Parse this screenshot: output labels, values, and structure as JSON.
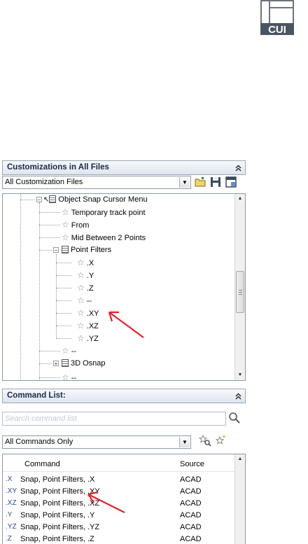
{
  "cui_icon": {
    "label": "CUI",
    "icon": "cui-icon"
  },
  "customizations": {
    "header": "Customizations in All Files",
    "collapse_glyph": "≈",
    "dropdown_value": "All Customization Files",
    "tree": [
      {
        "label": "Object Snap Cursor Menu",
        "type": "menu",
        "expanded": true
      },
      {
        "label": "Temporary track point",
        "type": "command"
      },
      {
        "label": "From",
        "type": "command"
      },
      {
        "label": "Mid Between 2 Points",
        "type": "command"
      },
      {
        "label": "Point Filters",
        "type": "menu",
        "expanded": true
      },
      {
        "label": ".X",
        "type": "command"
      },
      {
        "label": ".Y",
        "type": "command"
      },
      {
        "label": ".Z",
        "type": "command"
      },
      {
        "label": "--",
        "type": "command"
      },
      {
        "label": ".XY",
        "type": "command"
      },
      {
        "label": ".XZ",
        "type": "command"
      },
      {
        "label": ".YZ",
        "type": "command"
      },
      {
        "label": "--",
        "type": "command"
      },
      {
        "label": "3D Osnap",
        "type": "menu",
        "expanded": false
      },
      {
        "label": "--",
        "type": "command"
      }
    ]
  },
  "command_list": {
    "header": "Command List:",
    "collapse_glyph": "≈",
    "search_placeholder": "Search command list",
    "filter_value": "All Commands Only",
    "columns": {
      "command": "Command",
      "source": "Source"
    },
    "rows": [
      {
        "icon": ".X",
        "command": "Snap, Point Filters, .X",
        "source": "ACAD"
      },
      {
        "icon": ".XY",
        "command": "Snap, Point Filters, .XY",
        "source": "ACAD"
      },
      {
        "icon": ".XZ",
        "command": "Snap, Point Filters, .XZ",
        "source": "ACAD"
      },
      {
        "icon": ".Y",
        "command": "Snap, Point Filters, .Y",
        "source": "ACAD"
      },
      {
        "icon": ".YZ",
        "command": "Snap, Point Filters, .YZ",
        "source": "ACAD"
      },
      {
        "icon": ".Z",
        "command": "Snap, Point Filters, .Z",
        "source": "ACAD"
      }
    ]
  },
  "colors": {
    "annotation_arrow": "#e8202a",
    "header_text": "#1b2a48"
  }
}
